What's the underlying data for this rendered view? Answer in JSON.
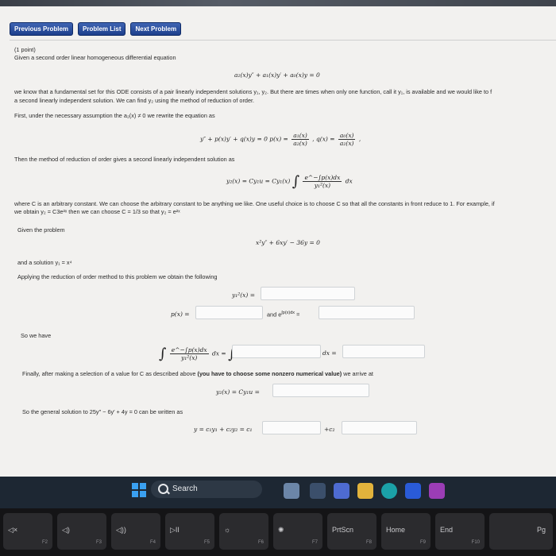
{
  "nav": {
    "previous": "Previous Problem",
    "list": "Problem List",
    "next": "Next Problem"
  },
  "problem": {
    "points": "(1 point)",
    "intro": "Given a second order linear homogeneous differential equation",
    "eq1": "a₂(x)y″ + a₁(x)y′ + a₀(x)y = 0",
    "p1": "we know that a fundamental set for this ODE consists of a pair linearly independent solutions y₁, y₂. But there are times when only one function, call it y₁, is available and we would like to f",
    "p1b": "a second linearly independent solution. We can find y₂ using the method of reduction of order.",
    "p2": "First, under the necessary assumption the a₂(x) ≠ 0 we rewrite the equation as",
    "eq2": "y″ + p(x)y′ + q(x)y = 0   p(x) =",
    "eq2_num1": "a₁(x)",
    "eq2_den1": "a₂(x)",
    "eq2_mid": ",  q(x) =",
    "eq2_num2": "a₀(x)",
    "eq2_den2": "a₂(x)",
    "eq2_end": ",",
    "p3": "Then the method of reduction of order gives a second linearly independent solution as",
    "eq3": "y₂(x) = Cy₁u = Cy₁(x)",
    "eq3_num": "e^−∫p(x)dx",
    "eq3_den": "y₁²(x)",
    "eq3_tail": "dx",
    "p4": "where C is an arbitrary constant. We can choose the arbitrary constant to be anything we like. One useful choice is to choose C so that all the constants in front reduce to 1. For example, if",
    "p4b": "we obtain y₂ = C3e²ˣ then we can choose C = 1/3 so that y₂ = e²ˣ",
    "given": "Given the problem",
    "eq4": "x²y″ + 6xy′ − 36y = 0",
    "sol": "and a solution y₁ = x⁴",
    "apply": "Applying the reduction of order method to this problem we obtain the following",
    "y1sq": "y₁²(x) =",
    "px": "p(x) =",
    "and_e": "and e",
    "and_e_sup": "∫p(x)dx",
    "and_e_eq": "=",
    "sowehave": "So we have",
    "int_num": "e^−∫p(x)dx",
    "int_den": "y₁²(x)",
    "int_mid": "dx =",
    "int_dx": "dx =",
    "finally_a": "Finally, after making a selection of a value for C as described above",
    "finally_b": "(you have to choose some nonzero numerical value)",
    "finally_c": "we arrive at",
    "y2eq": "y₂(x) = Cy₁u =",
    "general": "So the general solution to 25y″ − 6y′ + 4y = 0 can be written as",
    "gen_eq": "y = c₁y₁ + c₂y₂ = c₁",
    "gen_plus": "+c₂"
  },
  "taskbar": {
    "search": "Search"
  },
  "keyboard": [
    {
      "label": "◁×",
      "sub": "F2"
    },
    {
      "label": "◁)",
      "sub": "F3"
    },
    {
      "label": "◁))",
      "sub": "F4"
    },
    {
      "label": "▷II",
      "sub": "F5"
    },
    {
      "label": "☼",
      "sub": "F6"
    },
    {
      "label": "✺",
      "sub": "F7"
    },
    {
      "label": "PrtScn",
      "sub": "F8"
    },
    {
      "label": "Home",
      "sub": "F9"
    },
    {
      "label": "End",
      "sub": "F10"
    },
    {
      "label": "Pg",
      "sub": ""
    }
  ]
}
